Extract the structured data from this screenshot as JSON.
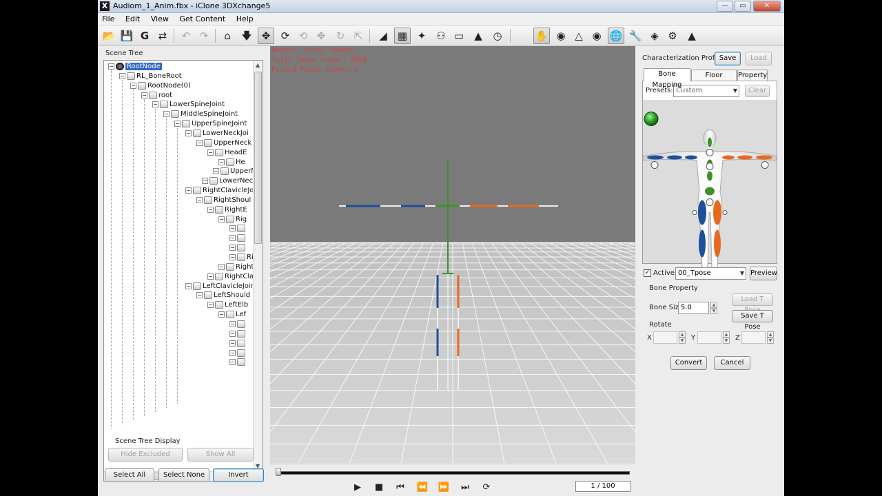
{
  "window": {
    "title": "Audiom_1_Anim.fbx - iClone 3DXchange5",
    "app_icon": "x-logo-icon",
    "minimize_label": "—",
    "maximize_label": "▭",
    "close_label": "✕"
  },
  "menu": [
    "File",
    "Edit",
    "View",
    "Get Content",
    "Help"
  ],
  "toolbar": {
    "icons": [
      "open-folder-icon",
      "save-icon",
      "g-icon",
      "convert-icon",
      "undo-icon",
      "redo-icon",
      "home-icon",
      "down-arrow-icon",
      "move-icon",
      "rotate-icon",
      "rotate2-icon",
      "scale-icon",
      "reset-icon",
      "resize-icon",
      "select-icon",
      "grid-icon",
      "bone-icon",
      "figure-icon",
      "box-icon",
      "pivot-icon",
      "sphere-icon",
      "hand-icon",
      "camera-icon",
      "character-icon",
      "eye-icon",
      "globe-icon",
      "wrench-icon",
      "paint-icon",
      "gear-icon",
      "export-icon"
    ]
  },
  "scene_tree": {
    "label": "Scene Tree",
    "nodes": [
      {
        "label": "RootNode",
        "selected": true
      },
      {
        "label": "RL_BoneRoot"
      },
      {
        "label": "RootNode(0)"
      },
      {
        "label": "root"
      },
      {
        "label": "LowerSpineJoint"
      },
      {
        "label": "MiddleSpineJoint"
      },
      {
        "label": "UpperSpineJoint"
      },
      {
        "label": "LowerNeckJoi"
      },
      {
        "label": "UpperNeck"
      },
      {
        "label": "HeadE"
      },
      {
        "label": "He"
      },
      {
        "label": "UpperN"
      },
      {
        "label": "LowerNeck"
      },
      {
        "label": "RightClavicleJo"
      },
      {
        "label": "RightShoul"
      },
      {
        "label": "RightE"
      },
      {
        "label": "Rig"
      },
      {
        "label": ""
      },
      {
        "label": ""
      },
      {
        "label": ""
      },
      {
        "label": "Rig"
      },
      {
        "label": "RightS"
      },
      {
        "label": "RightClavic"
      },
      {
        "label": "LeftClavicleJoin"
      },
      {
        "label": "LeftShould"
      },
      {
        "label": "LeftElb"
      },
      {
        "label": "Lef"
      },
      {
        "label": ""
      },
      {
        "label": ""
      },
      {
        "label": ""
      },
      {
        "label": ""
      },
      {
        "label": ""
      }
    ],
    "display_label": "Scene Tree Display",
    "hide_excluded": "Hide Excluded",
    "show_all": "Show All",
    "select_all": "Select All",
    "select_none": "Select None",
    "invert": "Invert"
  },
  "viewport": {
    "render_info": "Render: Pixel Shader",
    "total_faces": "Total Faces Count: 2088",
    "picked_faces": "Picked Faces Count: 0"
  },
  "timeline": {
    "frame": "1 / 100",
    "controls": [
      "play-icon",
      "stop-icon",
      "prev-key-icon",
      "rewind-icon",
      "fast-forward-icon",
      "next-key-icon",
      "loop-icon"
    ]
  },
  "characterization": {
    "profile_label": "Characterization Profile",
    "save": "Save",
    "load": "Load",
    "tabs": [
      "Bone Mapping",
      "Floor Contact",
      "Property"
    ],
    "presets_label": "Presets:",
    "preset_value": "Custom",
    "clear": "Clear",
    "status_icon": "green-status-icon",
    "active_label": "Active",
    "active_checked": true,
    "pose_value": "00_Tpose",
    "preview": "Preview",
    "bone_property_label": "Bone Property",
    "bone_size_label": "Bone Size",
    "bone_size_value": "5.0",
    "load_t_pose": "Load T Pose",
    "save_t_pose": "Save T Pose",
    "rotate_label": "Rotate",
    "x_label": "X",
    "y_label": "Y",
    "z_label": "Z",
    "convert": "Convert",
    "cancel": "Cancel",
    "colors": {
      "left_bones": "#e8691e",
      "right_bones": "#1e4f9c",
      "spine": "#3f8f2c"
    }
  }
}
